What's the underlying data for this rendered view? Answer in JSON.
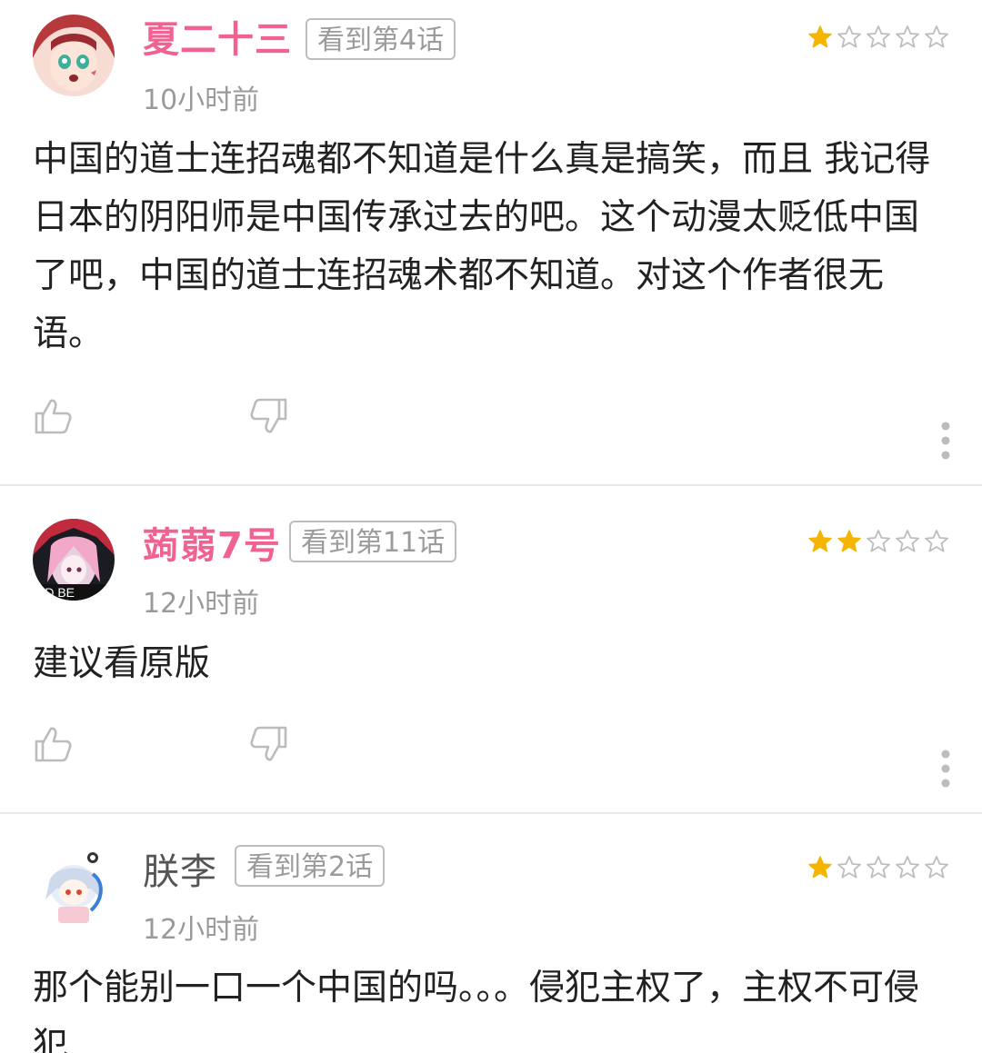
{
  "comments": [
    {
      "username": "夏二十三",
      "username_color": "#f06292",
      "progress": "看到第4话",
      "rating": 1,
      "timestamp": "10小时前",
      "body": "中国的道士连招魂都不知道是什么真是搞笑，而且 我记得日本的阴阳师是中国传承过去的吧。这个动漫太贬低中国了吧，中国的道士连招魂术都不知道。对这个作者很无语。"
    },
    {
      "username": "蒟蒻7号",
      "username_color": "#f06292",
      "progress": "看到第11话",
      "rating": 2,
      "timestamp": "12小时前",
      "body": "建议看原版"
    },
    {
      "username": "朕李",
      "username_color": "#555555",
      "progress": "看到第2话",
      "rating": 1,
      "timestamp": "12小时前",
      "body": "那个能别一口一个中国的吗。。。侵犯主权了，主权不可侵犯"
    }
  ],
  "rating_max": 5,
  "colors": {
    "star_filled": "#f5b400",
    "star_empty": "#bdbdbd",
    "icon": "#bcbcbc",
    "divider": "#e9e9e9"
  },
  "icons": {
    "like": "thumbs-up-icon",
    "dislike": "thumbs-down-icon",
    "more": "more-vertical-icon"
  }
}
